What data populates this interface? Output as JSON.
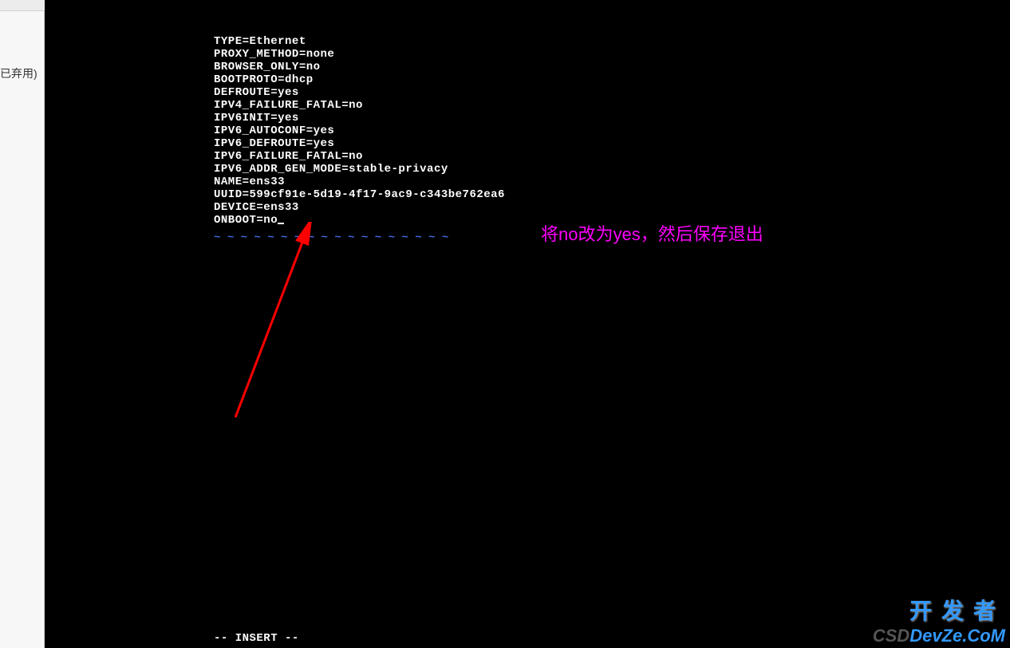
{
  "leftPanel": {
    "label": "已弃用)"
  },
  "terminal": {
    "lines": [
      "TYPE=Ethernet",
      "PROXY_METHOD=none",
      "BROWSER_ONLY=no",
      "BOOTPROTO=dhcp",
      "DEFROUTE=yes",
      "IPV4_FAILURE_FATAL=no",
      "IPV6INIT=yes",
      "IPV6_AUTOCONF=yes",
      "IPV6_DEFROUTE=yes",
      "IPV6_FAILURE_FATAL=no",
      "IPV6_ADDR_GEN_MODE=stable-privacy",
      "NAME=ens33",
      "UUID=599cf91e-5d19-4f17-9ac9-c343be762ea6",
      "DEVICE=ens33",
      "ONBOOT=no"
    ],
    "tilde": "~",
    "statusLine": "-- INSERT --"
  },
  "annotation": {
    "text": "将no改为yes，然后保存退出"
  },
  "watermark": {
    "dev": "开发者",
    "csd": "CSD",
    "devze": "DevZe.CoM"
  }
}
